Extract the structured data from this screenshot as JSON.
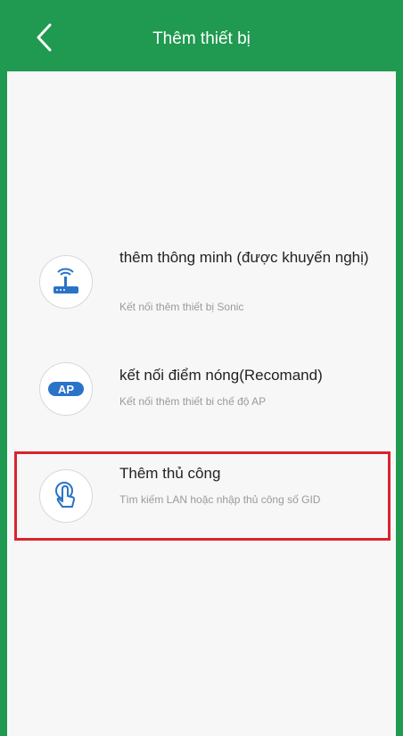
{
  "colors": {
    "brand_green": "#1f9a50",
    "highlight_red": "#d9242f",
    "icon_blue": "#2a73c8"
  },
  "header": {
    "back_icon": "chevron-left-icon",
    "title": "Thêm thiết bị"
  },
  "options": [
    {
      "icon": "router-wifi-icon",
      "title": "thêm thông minh (được khuyến nghị)",
      "subtitle": "Kết nối thêm thiết bị Sonic"
    },
    {
      "icon": "ap-badge-icon",
      "icon_text": "AP",
      "title": "kết nối điểm nóng(Recomand)",
      "subtitle": "Kết nối thêm thiết bi chế độ AP"
    },
    {
      "icon": "hand-tap-icon",
      "title": "Thêm thủ công",
      "subtitle": "Tìm kiếm LAN hoặc nhập thủ công số GID",
      "highlighted": true
    }
  ]
}
